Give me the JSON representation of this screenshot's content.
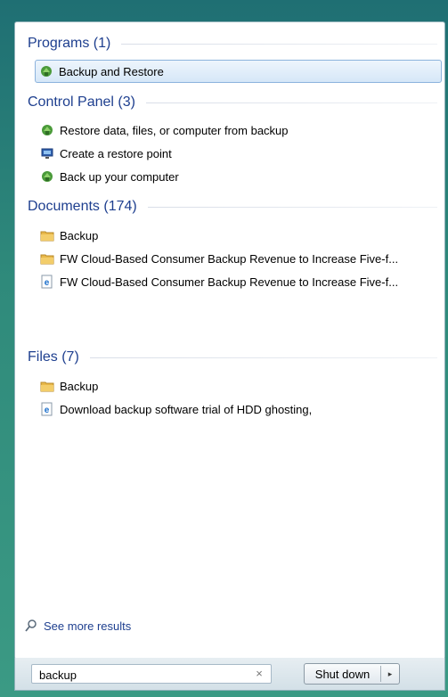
{
  "programs": {
    "header": "Programs (1)",
    "items": [
      {
        "label": "Backup and Restore",
        "icon": "backup-restore-icon"
      }
    ]
  },
  "control_panel": {
    "header": "Control Panel (3)",
    "items": [
      {
        "label": "Restore data, files, or computer from backup",
        "icon": "backup-restore-icon"
      },
      {
        "label": "Create a restore point",
        "icon": "system-restore-icon"
      },
      {
        "label": "Back up your computer",
        "icon": "backup-restore-icon"
      }
    ]
  },
  "documents": {
    "header": "Documents (174)",
    "items": [
      {
        "label": "Backup",
        "icon": "folder-icon"
      },
      {
        "label": "FW Cloud-Based Consumer Backup Revenue to Increase Five-f...",
        "icon": "folder-icon"
      },
      {
        "label": "FW Cloud-Based Consumer Backup Revenue to Increase Five-f...",
        "icon": "ie-document-icon"
      }
    ]
  },
  "files": {
    "header": "Files (7)",
    "items": [
      {
        "label": "Backup",
        "icon": "folder-icon"
      },
      {
        "label": "Download backup software trial of HDD ghosting,",
        "icon": "ie-document-icon"
      }
    ]
  },
  "see_more": "See more results",
  "search": {
    "value": "backup",
    "clear_glyph": "×"
  },
  "shutdown": {
    "label": "Shut down",
    "arrow": "▸"
  }
}
